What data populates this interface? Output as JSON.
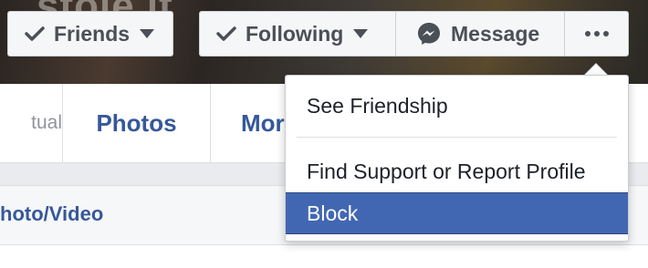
{
  "cover": {
    "overlay_text": "stole it"
  },
  "action_bar": {
    "friends_label": "Friends",
    "following_label": "Following",
    "message_label": "Message",
    "more_glyph": "•••"
  },
  "tabs": {
    "mutual_fragment": "tual",
    "photos_label": "Photos",
    "more_fragment": "Mor"
  },
  "composer": {
    "label_fragment": "hoto/Video"
  },
  "dropdown": {
    "items": [
      {
        "label": "See Friendship"
      },
      {
        "label": "Find Support or Report Profile"
      },
      {
        "label": "Block",
        "highlighted": true
      }
    ]
  },
  "colors": {
    "link_blue": "#365899",
    "highlight_blue": "#4267b2",
    "button_bg": "#f5f6f7",
    "button_text": "#4b4f56"
  },
  "icons": [
    "checkmark-icon",
    "caret-down-icon",
    "messenger-icon",
    "more-dots-icon"
  ]
}
